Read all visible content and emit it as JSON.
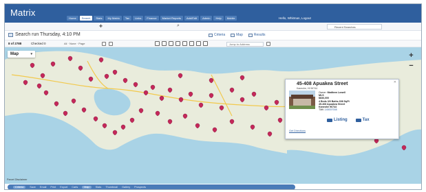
{
  "app": {
    "brand": "Matrix",
    "nav": [
      "Home",
      "Search",
      "Stats",
      "My Matrix",
      "Tax",
      "Links",
      "Finance",
      "Market Reports",
      "Add/Edit",
      "Admin",
      "Help",
      "Mobile"
    ],
    "active_nav": 1,
    "user_greeting": "Hello, Whitman, Logout"
  },
  "subbar": {
    "recent_searches": "Recent Searches"
  },
  "search": {
    "run_text": "Search run Thursday, 4:10 PM",
    "view_tabs": [
      "Criteria",
      "Map",
      "Results"
    ]
  },
  "toolbar": {
    "count": "8 of 2788",
    "checked": "Checked 0",
    "page_select": "All · None · Page",
    "address_select": "Jump to Address"
  },
  "map": {
    "type_label": "Map",
    "zoom_in": "+",
    "zoom_out": "−",
    "land_color": "#e9ecdc",
    "water_color": "#a9d3e6",
    "pin_color": "#c4285a"
  },
  "listing": {
    "address": "45-408 Apuakea Street",
    "city": "Kaneohe, HI 96744",
    "owner_label": "Owner:",
    "owner": "Matthew Lowell",
    "mls_label": "MLS",
    "price": "$836,000",
    "beds_baths": "4 Beds 3/0 Baths 608 SqFt",
    "street": "45-408 Apuakea Street",
    "city_zip": "Kaneohe 96744",
    "tmk_label": "TMK",
    "tmk": "145007008",
    "link_listing": "Listing",
    "link_tax": "Tax",
    "directions": "Get Directions"
  },
  "footer": {
    "parcel_disclaimer": "Parcel Disclaimer",
    "actions": [
      "Criteria",
      "Save",
      "Email",
      "Print",
      "Export",
      "Carts",
      "Map",
      "Stats",
      "Thumbnail",
      "Gallery",
      "Prospects"
    ]
  }
}
